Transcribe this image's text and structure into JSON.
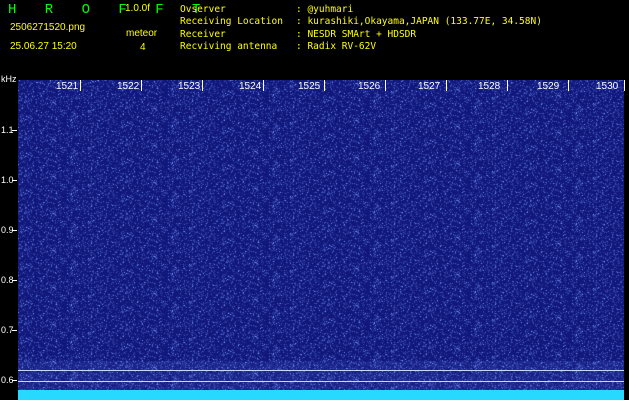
{
  "header": {
    "brand": "H R O F F T",
    "version": "1.0.0f",
    "filename": "2506271520.png",
    "mode": "meteor",
    "datetime": "25.06.27 15:20",
    "count": "4",
    "info": [
      {
        "key": "Ovserver",
        "value": ": @yuhmari"
      },
      {
        "key": "Receiving Location",
        "value": ": kurashiki,Okayama,JAPAN (133.77E, 34.58N)"
      },
      {
        "key": "Receiver",
        "value": ": NESDR SMArt + HDSDR"
      },
      {
        "key": "Recviving antenna",
        "value": ": Radix RV-62V"
      }
    ]
  },
  "axes": {
    "y_unit": "kHz",
    "y_ticks": [
      "1.1",
      "1.0",
      "0.9",
      "0.8",
      "0.7",
      "0.6"
    ],
    "x_ticks": [
      "1521",
      "1522",
      "1523",
      "1524",
      "1525",
      "1526",
      "1527",
      "1528",
      "1529",
      "1530"
    ]
  },
  "colors": {
    "header_bg": "#000000",
    "plot_bg": "#10167a",
    "noise": "#5f7cff",
    "signal_band": "#27d9ff",
    "brand": "#00ff00",
    "version": "#ffff00",
    "info_text": "#ffff00"
  }
}
